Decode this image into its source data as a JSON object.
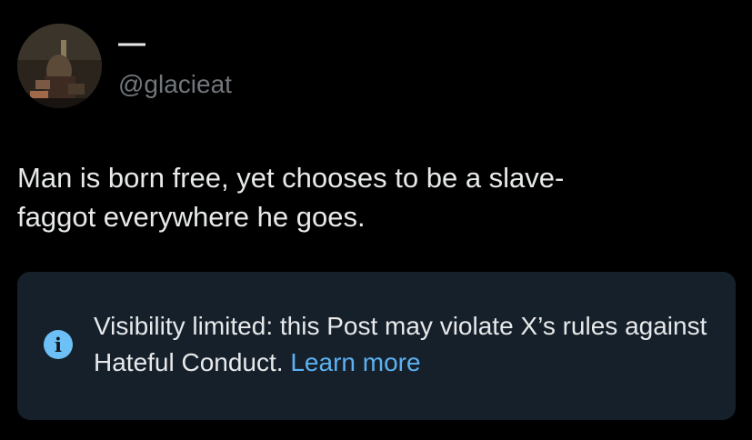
{
  "author": {
    "display_name": "—",
    "handle": "@glacieat",
    "avatar_icon": "avatar-photo"
  },
  "post": {
    "text": "Man is born free, yet chooses to be a slave-\nfaggot everywhere he goes."
  },
  "notice": {
    "icon": "info-icon",
    "icon_glyph": "i",
    "message": "Visibility limited: this Post may violate X’s rules against Hateful Conduct.",
    "link_label": "Learn more"
  },
  "colors": {
    "background": "#000000",
    "text_primary": "#e7e9ea",
    "text_secondary": "#71767b",
    "notice_background": "#16202a",
    "link": "#5cb1f2",
    "info_icon": "#6cc0f5"
  }
}
